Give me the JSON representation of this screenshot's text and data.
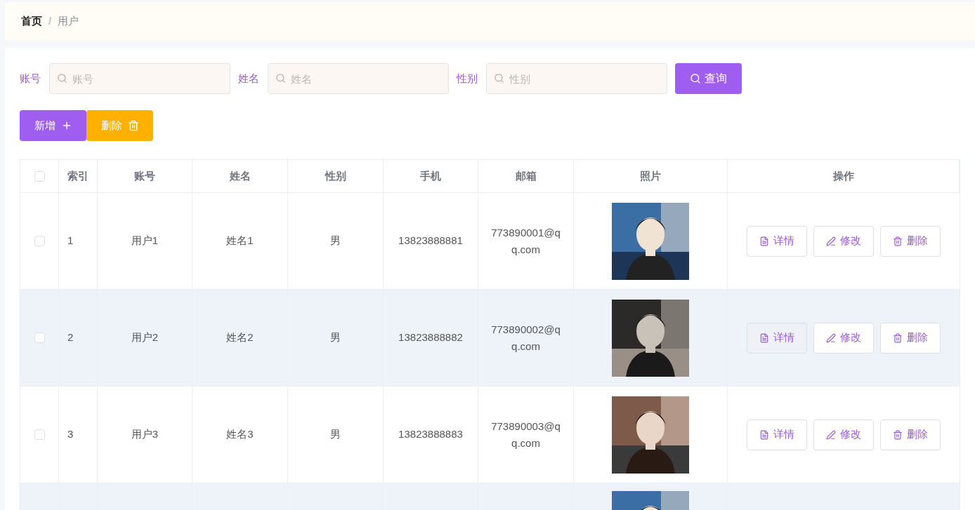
{
  "breadcrumb": [
    {
      "label": "首页",
      "current": false
    },
    {
      "label": "用户",
      "current": true
    }
  ],
  "breadcrumb_separator": "/",
  "filters": [
    {
      "label": "账号",
      "placeholder": "账号"
    },
    {
      "label": "姓名",
      "placeholder": "姓名"
    },
    {
      "label": "性别",
      "placeholder": "性别"
    }
  ],
  "search_button": "查询",
  "toolbar": [
    {
      "label": "新增",
      "kind": "add"
    },
    {
      "label": "删除",
      "kind": "delete"
    }
  ],
  "table": {
    "select_all_checked": false,
    "columns": [
      "索引",
      "账号",
      "姓名",
      "性别",
      "手机",
      "邮箱",
      "照片",
      "操作"
    ],
    "rows": [
      {
        "checked": false,
        "highlighted": false,
        "index": "1",
        "account": "用户1",
        "name": "姓名1",
        "gender": "男",
        "phone": "13823888881",
        "email": [
          "773890001@q",
          "q.com"
        ],
        "photo": {
          "kind": "picture"
        },
        "actions": [
          {
            "label": "详情",
            "kind": "detail",
            "hover": false
          },
          {
            "label": "修改",
            "kind": "edit",
            "hover": false
          },
          {
            "label": "删除",
            "kind": "delete",
            "hover": false
          }
        ]
      },
      {
        "checked": false,
        "highlighted": true,
        "index": "2",
        "account": "用户2",
        "name": "姓名2",
        "gender": "男",
        "phone": "13823888882",
        "email": [
          "773890002@q",
          "q.com"
        ],
        "photo": {
          "kind": "picture"
        },
        "actions": [
          {
            "label": "详情",
            "kind": "detail",
            "hover": true
          },
          {
            "label": "修改",
            "kind": "edit",
            "hover": false
          },
          {
            "label": "删除",
            "kind": "delete",
            "hover": false
          }
        ]
      },
      {
        "checked": false,
        "highlighted": false,
        "index": "3",
        "account": "用户3",
        "name": "姓名3",
        "gender": "男",
        "phone": "13823888883",
        "email": [
          "773890003@q",
          "q.com"
        ],
        "photo": {
          "kind": "picture"
        },
        "actions": [
          {
            "label": "详情",
            "kind": "detail",
            "hover": false
          },
          {
            "label": "修改",
            "kind": "edit",
            "hover": false
          },
          {
            "label": "删除",
            "kind": "delete",
            "hover": false
          }
        ]
      }
    ],
    "partial_row": {
      "highlighted": true,
      "photo": {
        "kind": "picture"
      }
    }
  }
}
